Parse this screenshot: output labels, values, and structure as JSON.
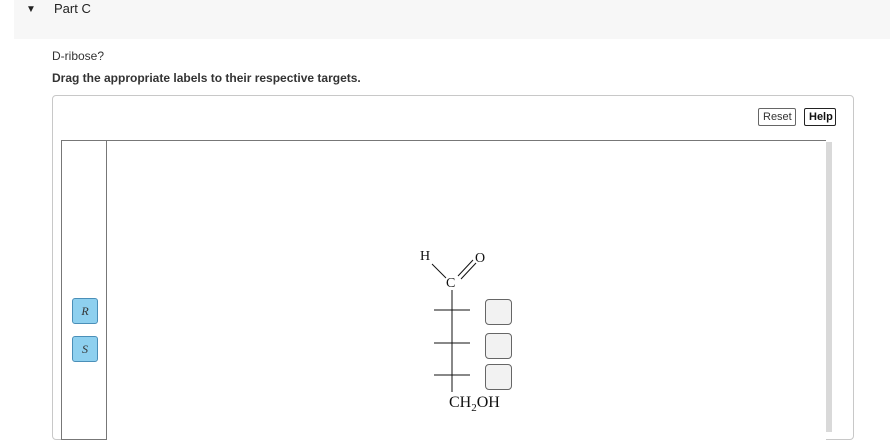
{
  "part": {
    "toggle_icon": "caret-down-icon",
    "title": "Part C"
  },
  "question": "D-ribose?",
  "instruction": "Drag the appropriate labels to their respective targets.",
  "toolbar": {
    "reset_label": "Reset",
    "help_label": "Help"
  },
  "labels": [
    "R",
    "S"
  ],
  "molecule": {
    "top_h": "H",
    "top_o": "O",
    "top_c": "C",
    "bottom_group_main": "CH",
    "bottom_group_sub": "2",
    "bottom_group_tail": "OH"
  },
  "targets_count": 3
}
